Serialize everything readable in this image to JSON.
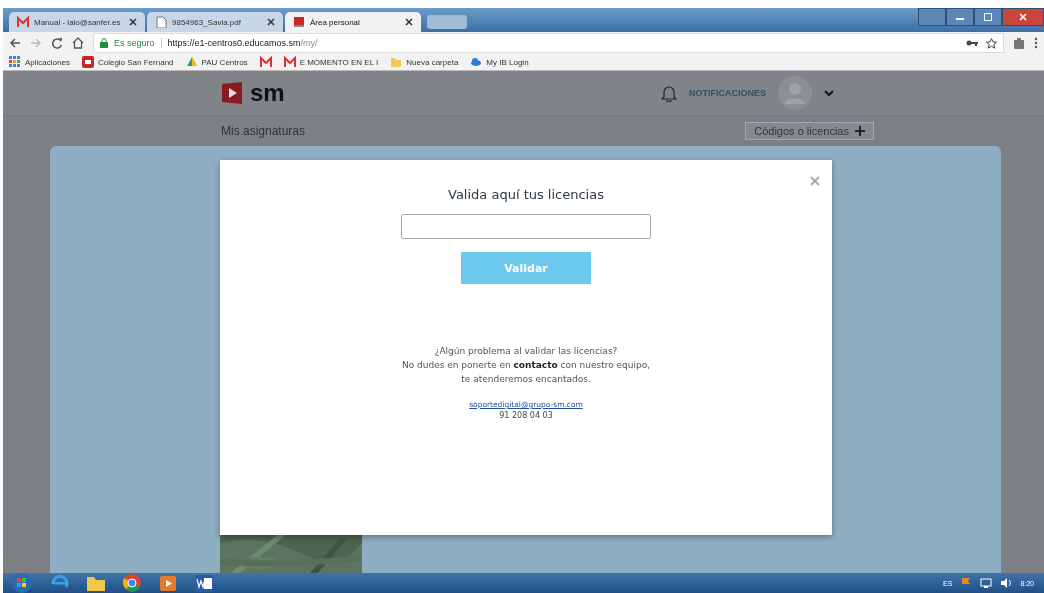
{
  "browser": {
    "tabs": [
      {
        "title": "Manual - lalo@sanfer.es",
        "kind": "mail",
        "selected": false
      },
      {
        "title": "9854963_Savia.pdf",
        "kind": "doc",
        "selected": false
      },
      {
        "title": "Área personal",
        "kind": "site",
        "selected": true
      }
    ],
    "security": "Es seguro",
    "url_host": "https://e1-centros0.educamos.sm",
    "url_path": "/my/",
    "bookmarks": [
      {
        "label": "Aplicaciones",
        "kind": "apps"
      },
      {
        "label": "Colegio San Fernand",
        "kind": "square"
      },
      {
        "label": "PAU Centros",
        "kind": "drive"
      },
      {
        "kind": "mail"
      },
      {
        "label": "E MOMENTO EN EL I",
        "kind": "mail"
      },
      {
        "label": "Nueva carpeta",
        "kind": "folder"
      },
      {
        "label": "My IB Login",
        "kind": "cloud"
      }
    ]
  },
  "site": {
    "logo": "sm",
    "notifications": "NOTIFICACIONES",
    "section": "Mis asignaturas",
    "codes_button": "Códigos o licencias"
  },
  "modal": {
    "title": "Valida aquí tus licencias",
    "button": "Validar",
    "help": "¿Algún problema al validar las licencias?\nNo dudes en ponerte en **contacto** con nuestro equipo,\nte atenderemos encantados.",
    "email": "soportedigital@grupo-sm.com",
    "phone": "91 208 04 03"
  },
  "taskbar": {
    "language": "ES",
    "time": "8:20"
  }
}
